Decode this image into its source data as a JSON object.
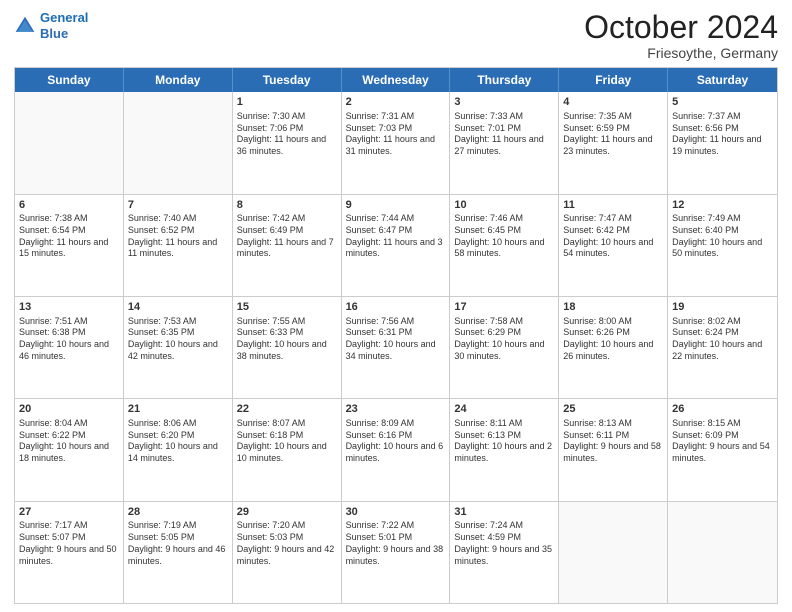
{
  "header": {
    "logo_line1": "General",
    "logo_line2": "Blue",
    "month": "October 2024",
    "location": "Friesoythe, Germany"
  },
  "weekdays": [
    "Sunday",
    "Monday",
    "Tuesday",
    "Wednesday",
    "Thursday",
    "Friday",
    "Saturday"
  ],
  "rows": [
    [
      {
        "day": "",
        "text": ""
      },
      {
        "day": "",
        "text": ""
      },
      {
        "day": "1",
        "text": "Sunrise: 7:30 AM\nSunset: 7:06 PM\nDaylight: 11 hours and 36 minutes."
      },
      {
        "day": "2",
        "text": "Sunrise: 7:31 AM\nSunset: 7:03 PM\nDaylight: 11 hours and 31 minutes."
      },
      {
        "day": "3",
        "text": "Sunrise: 7:33 AM\nSunset: 7:01 PM\nDaylight: 11 hours and 27 minutes."
      },
      {
        "day": "4",
        "text": "Sunrise: 7:35 AM\nSunset: 6:59 PM\nDaylight: 11 hours and 23 minutes."
      },
      {
        "day": "5",
        "text": "Sunrise: 7:37 AM\nSunset: 6:56 PM\nDaylight: 11 hours and 19 minutes."
      }
    ],
    [
      {
        "day": "6",
        "text": "Sunrise: 7:38 AM\nSunset: 6:54 PM\nDaylight: 11 hours and 15 minutes."
      },
      {
        "day": "7",
        "text": "Sunrise: 7:40 AM\nSunset: 6:52 PM\nDaylight: 11 hours and 11 minutes."
      },
      {
        "day": "8",
        "text": "Sunrise: 7:42 AM\nSunset: 6:49 PM\nDaylight: 11 hours and 7 minutes."
      },
      {
        "day": "9",
        "text": "Sunrise: 7:44 AM\nSunset: 6:47 PM\nDaylight: 11 hours and 3 minutes."
      },
      {
        "day": "10",
        "text": "Sunrise: 7:46 AM\nSunset: 6:45 PM\nDaylight: 10 hours and 58 minutes."
      },
      {
        "day": "11",
        "text": "Sunrise: 7:47 AM\nSunset: 6:42 PM\nDaylight: 10 hours and 54 minutes."
      },
      {
        "day": "12",
        "text": "Sunrise: 7:49 AM\nSunset: 6:40 PM\nDaylight: 10 hours and 50 minutes."
      }
    ],
    [
      {
        "day": "13",
        "text": "Sunrise: 7:51 AM\nSunset: 6:38 PM\nDaylight: 10 hours and 46 minutes."
      },
      {
        "day": "14",
        "text": "Sunrise: 7:53 AM\nSunset: 6:35 PM\nDaylight: 10 hours and 42 minutes."
      },
      {
        "day": "15",
        "text": "Sunrise: 7:55 AM\nSunset: 6:33 PM\nDaylight: 10 hours and 38 minutes."
      },
      {
        "day": "16",
        "text": "Sunrise: 7:56 AM\nSunset: 6:31 PM\nDaylight: 10 hours and 34 minutes."
      },
      {
        "day": "17",
        "text": "Sunrise: 7:58 AM\nSunset: 6:29 PM\nDaylight: 10 hours and 30 minutes."
      },
      {
        "day": "18",
        "text": "Sunrise: 8:00 AM\nSunset: 6:26 PM\nDaylight: 10 hours and 26 minutes."
      },
      {
        "day": "19",
        "text": "Sunrise: 8:02 AM\nSunset: 6:24 PM\nDaylight: 10 hours and 22 minutes."
      }
    ],
    [
      {
        "day": "20",
        "text": "Sunrise: 8:04 AM\nSunset: 6:22 PM\nDaylight: 10 hours and 18 minutes."
      },
      {
        "day": "21",
        "text": "Sunrise: 8:06 AM\nSunset: 6:20 PM\nDaylight: 10 hours and 14 minutes."
      },
      {
        "day": "22",
        "text": "Sunrise: 8:07 AM\nSunset: 6:18 PM\nDaylight: 10 hours and 10 minutes."
      },
      {
        "day": "23",
        "text": "Sunrise: 8:09 AM\nSunset: 6:16 PM\nDaylight: 10 hours and 6 minutes."
      },
      {
        "day": "24",
        "text": "Sunrise: 8:11 AM\nSunset: 6:13 PM\nDaylight: 10 hours and 2 minutes."
      },
      {
        "day": "25",
        "text": "Sunrise: 8:13 AM\nSunset: 6:11 PM\nDaylight: 9 hours and 58 minutes."
      },
      {
        "day": "26",
        "text": "Sunrise: 8:15 AM\nSunset: 6:09 PM\nDaylight: 9 hours and 54 minutes."
      }
    ],
    [
      {
        "day": "27",
        "text": "Sunrise: 7:17 AM\nSunset: 5:07 PM\nDaylight: 9 hours and 50 minutes."
      },
      {
        "day": "28",
        "text": "Sunrise: 7:19 AM\nSunset: 5:05 PM\nDaylight: 9 hours and 46 minutes."
      },
      {
        "day": "29",
        "text": "Sunrise: 7:20 AM\nSunset: 5:03 PM\nDaylight: 9 hours and 42 minutes."
      },
      {
        "day": "30",
        "text": "Sunrise: 7:22 AM\nSunset: 5:01 PM\nDaylight: 9 hours and 38 minutes."
      },
      {
        "day": "31",
        "text": "Sunrise: 7:24 AM\nSunset: 4:59 PM\nDaylight: 9 hours and 35 minutes."
      },
      {
        "day": "",
        "text": ""
      },
      {
        "day": "",
        "text": ""
      }
    ]
  ]
}
